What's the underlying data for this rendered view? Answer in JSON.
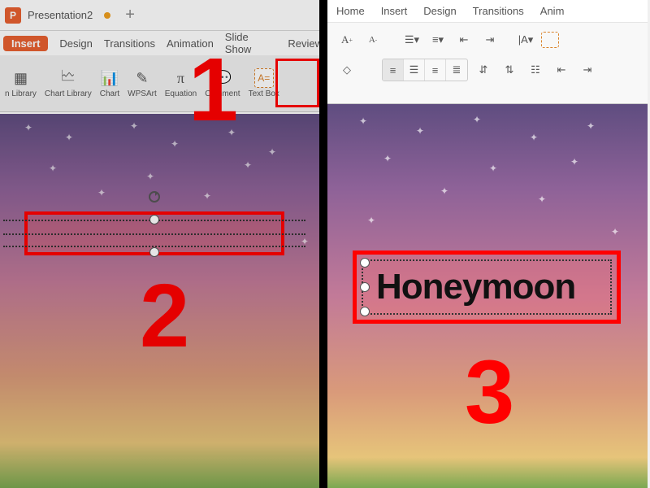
{
  "app": {
    "icon_letter": "P",
    "doc_title": "Presentation2",
    "new_tab_glyph": "+"
  },
  "left_tabs": {
    "insert": "Insert",
    "design": "Design",
    "transitions": "Transitions",
    "animation": "Animation",
    "slideshow": "Slide Show",
    "review": "Review"
  },
  "left_ribbon": {
    "item_a": "n Library",
    "item_b": "Chart Library",
    "item_c": "Chart",
    "item_d": "WPSArt",
    "item_e": "Equation",
    "item_f": "Comment",
    "item_g": "Text Box"
  },
  "right_tabs": {
    "home": "Home",
    "insert": "Insert",
    "design": "Design",
    "transitions": "Transitions",
    "anim": "Anim"
  },
  "textbox": {
    "content": "Honeymoon"
  },
  "steps": {
    "one": "1",
    "two": "2",
    "three": "3"
  },
  "colors": {
    "highlight": "#ff0000",
    "accent": "#e86030"
  }
}
